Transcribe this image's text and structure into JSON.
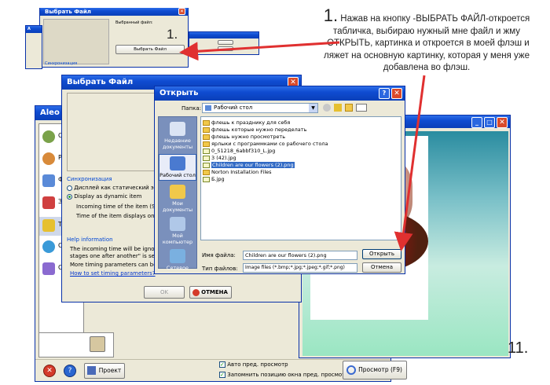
{
  "annotation": {
    "step_number": "1.",
    "text": "Нажав на кнопку -ВЫБРАТЬ ФАЙЛ-откроется табличка,  выбираю нужный мне файл и жму -ОТКРЫТЬ, картинка и откроется в моей флэш и ляжет на основную картинку, которая у меня уже добавлена во флэш.",
    "mini_step": "1.",
    "page_number": "11."
  },
  "top_dialog": {
    "title": "Выбрать Файл",
    "selected_label": "Выбранный файл:",
    "choose_button": "Выбрать Файл",
    "side_labels": [
      "Синхронизация"
    ]
  },
  "main_window": {
    "title": "Aleo",
    "left_items": [
      "O",
      "Pa",
      "Ф",
      "З",
      "Te",
      "C",
      "C"
    ],
    "footer": {
      "project_button": "Проект",
      "auto_preview": "Авто пред. просмотр",
      "remember_position": "Запомнить позицию окна пред. просмотра",
      "preview_button": "Просмотр  (F9)"
    }
  },
  "choose_dialog": {
    "title": "Выбрать Файл",
    "sync_group": "Синхронизация",
    "radio_static": "Дисплей как статический эл",
    "radio_dynamic": "Display as dynamic item",
    "incoming_time": "Incoming time of the item (S",
    "time_displays": "Time of the item displays on",
    "help_group": "Help information",
    "help_lines": [
      "The incoming time will be ignore",
      "stages one after another\" is sele",
      "More timing parameters can be"
    ],
    "help_link": "How to set timing parameters?",
    "ok_button": "OK",
    "cancel_button": "ОТМЕНА"
  },
  "open_dialog": {
    "title": "Открыть",
    "folder_label": "Папка:",
    "folder_value": "Рабочий стол",
    "sidebar": [
      "Недавние документы",
      "Рабочий стол",
      "Мои документы",
      "Мой компьютер",
      "Сетевое"
    ],
    "files": [
      {
        "name": "флешь к празднику для себя",
        "type": "folder"
      },
      {
        "name": "флешь которые нужно переделать",
        "type": "folder"
      },
      {
        "name": "флешь нужно просмотреть",
        "type": "folder"
      },
      {
        "name": "ярлыки с программками со рабочего стола",
        "type": "folder"
      },
      {
        "name": "0_51218_6abbf310_L.jpg",
        "type": "image"
      },
      {
        "name": "3 (42).jpg",
        "type": "image"
      },
      {
        "name": "Children are our flowers (2).png",
        "type": "image",
        "selected": true
      },
      {
        "name": "Norton Installation Files",
        "type": "folder"
      },
      {
        "name": "Б.jpg",
        "type": "image"
      }
    ],
    "filename_label": "Имя файла:",
    "filename_value": "Children are our flowers (2).png",
    "filetype_label": "Тип файлов:",
    "filetype_value": "Image files (*.bmp;*.jpg;*.jpeg;*.gif;*.png)",
    "open_button": "Открыть",
    "cancel_button": "Отмена"
  },
  "colors": {
    "xp_blue": "#0a3fb8",
    "xp_face": "#ece9d8",
    "arrow_red": "#e03030",
    "selection": "#316ac5"
  }
}
